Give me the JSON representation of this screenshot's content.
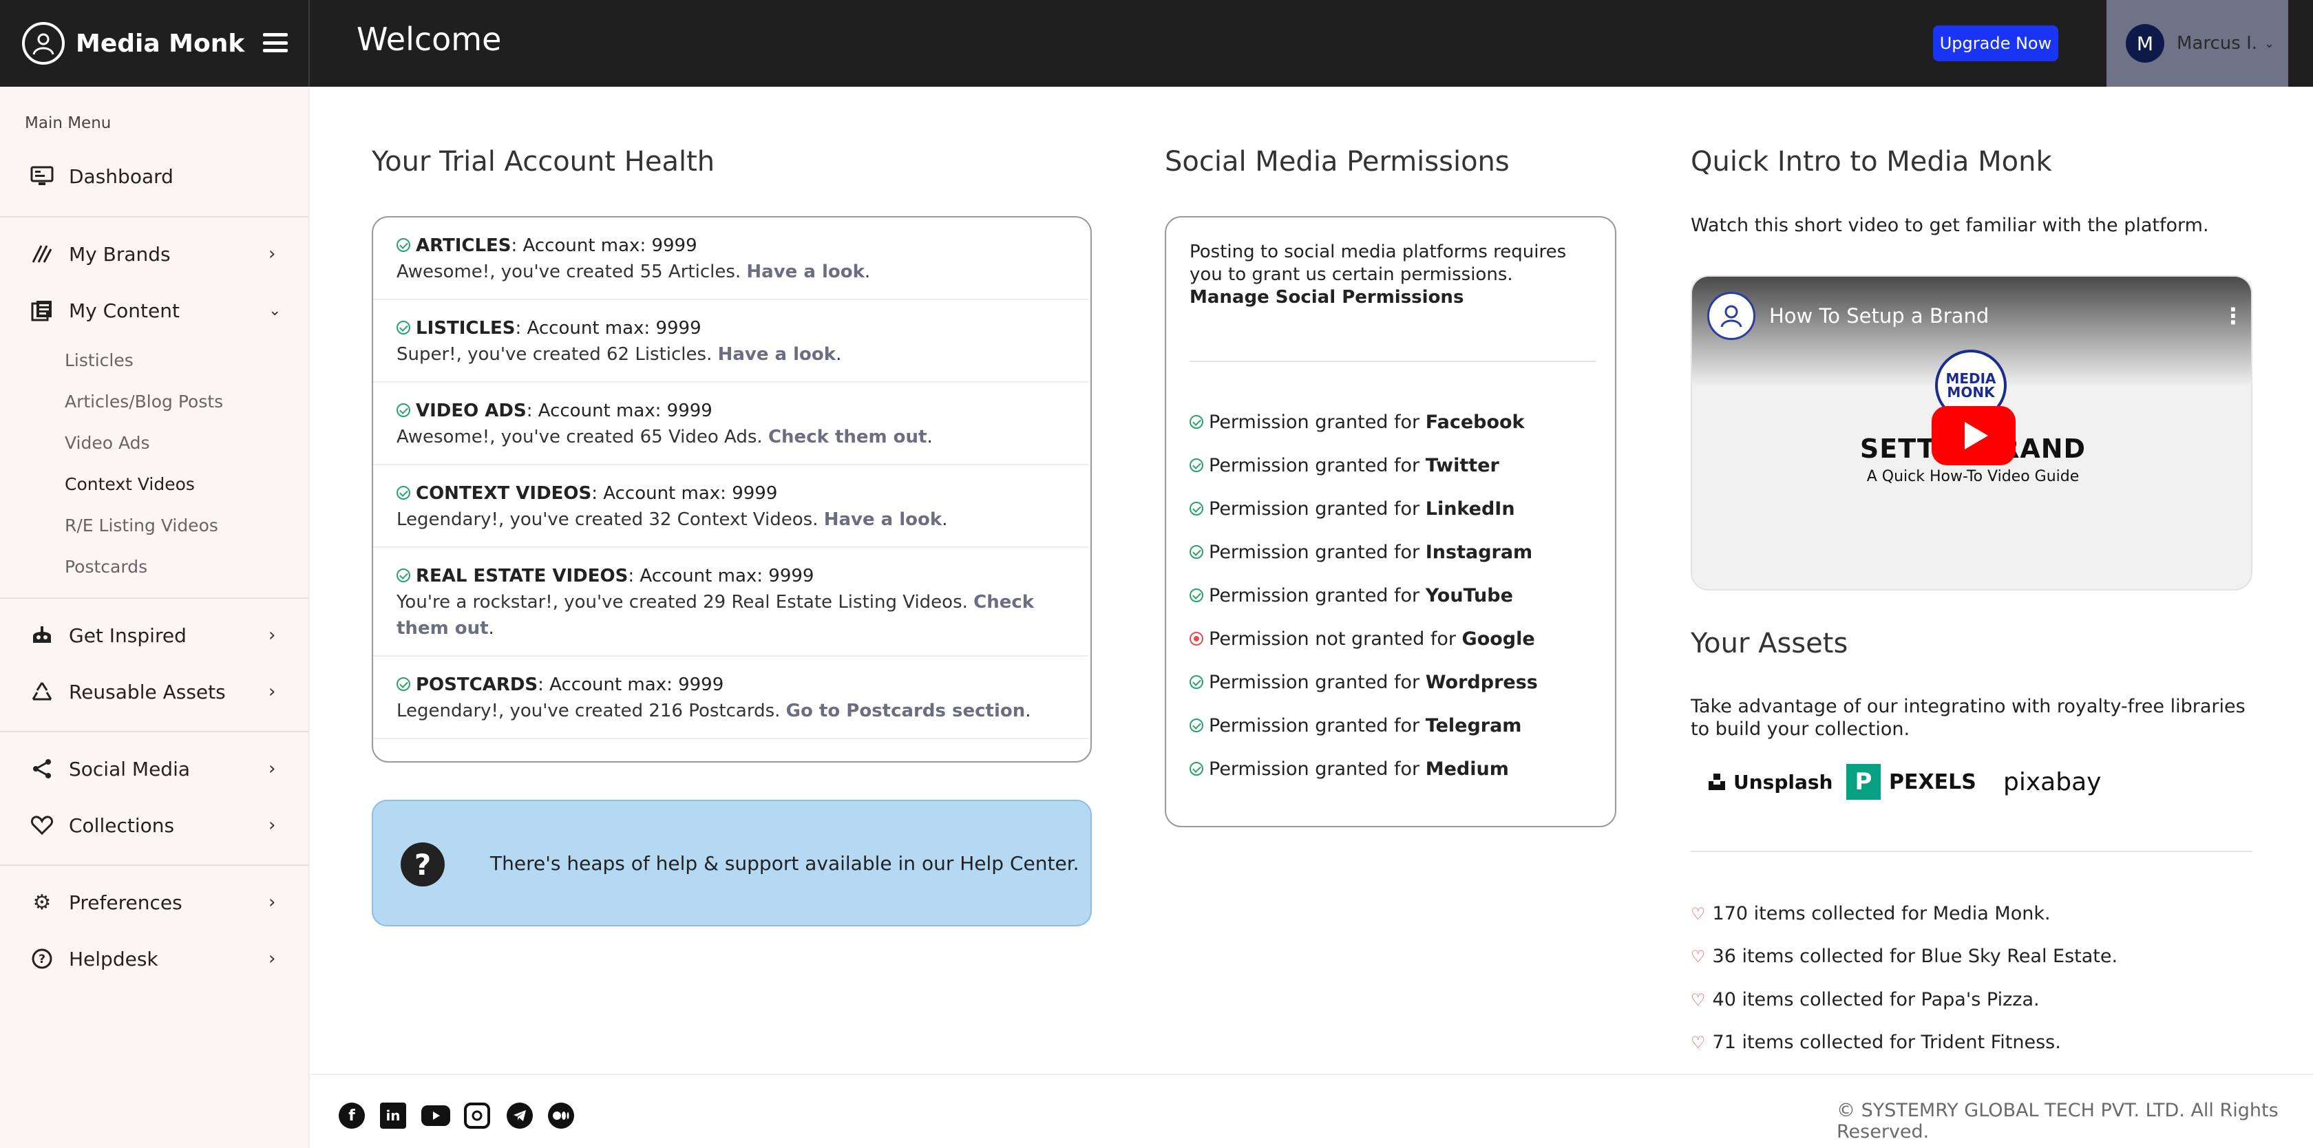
{
  "app": {
    "name": "Media Monk",
    "page_title": "Welcome"
  },
  "header": {
    "upgrade_label": "Upgrade Now",
    "user_initial": "M",
    "user_name": "Marcus I.",
    "caret": "⌄"
  },
  "sidebar": {
    "section_label": "Main Menu",
    "items": [
      {
        "label": "Dashboard",
        "icon": "monitor-icon"
      },
      {
        "label": "My Brands",
        "icon": "brands-icon"
      },
      {
        "label": "My Content",
        "icon": "content-icon"
      },
      {
        "label": "Get Inspired",
        "icon": "inspired-icon"
      },
      {
        "label": "Reusable Assets",
        "icon": "recycle-icon"
      },
      {
        "label": "Social Media",
        "icon": "share-icon"
      },
      {
        "label": "Collections",
        "icon": "heart-icon"
      },
      {
        "label": "Preferences",
        "icon": "gear-icon"
      },
      {
        "label": "Helpdesk",
        "icon": "help-icon"
      }
    ],
    "content_sub": [
      "Listicles",
      "Articles/Blog Posts",
      "Video Ads",
      "Context Videos",
      "R/E Listing Videos",
      "Postcards"
    ]
  },
  "health": {
    "title": "Your Trial Account Health",
    "rows": [
      {
        "name": "ARTICLES",
        "max": ": Account max: 9999",
        "msg": "Awesome!, you've created 55 Articles. ",
        "link": "Have a look",
        "end": "."
      },
      {
        "name": "LISTICLES",
        "max": ": Account max: 9999",
        "msg": "Super!, you've created 62 Listicles. ",
        "link": "Have a look",
        "end": "."
      },
      {
        "name": "VIDEO ADS",
        "max": ": Account max: 9999",
        "msg": "Awesome!, you've created 65 Video Ads. ",
        "link": "Check them out",
        "end": "."
      },
      {
        "name": "CONTEXT VIDEOS",
        "max": ": Account max: 9999",
        "msg": "Legendary!, you've created 32 Context Videos. ",
        "link": "Have a look",
        "end": "."
      },
      {
        "name": "REAL ESTATE VIDEOS",
        "max": ": Account max: 9999",
        "msg": "You're a rockstar!, you've created 29 Real Estate Listing Videos. ",
        "link": "Check them out",
        "end": "."
      },
      {
        "name": "POSTCARDS",
        "max": ": Account max: 9999",
        "msg": "Legendary!, you've created 216 Postcards. ",
        "link": "Go to Postcards section",
        "end": "."
      }
    ],
    "help_icon": "?",
    "help_text": "There's heaps of help & support available in our Help Center."
  },
  "permissions": {
    "title": "Social Media Permissions",
    "intro": "Posting to social media platforms requires you to grant us certain permissions. ",
    "intro_link": "Manage Social Permissions",
    "items": [
      {
        "text": "Permission granted for ",
        "platform": "Facebook",
        "granted": true
      },
      {
        "text": "Permission granted for ",
        "platform": "Twitter",
        "granted": true
      },
      {
        "text": "Permission granted for ",
        "platform": "LinkedIn",
        "granted": true
      },
      {
        "text": "Permission granted for ",
        "platform": "Instagram",
        "granted": true
      },
      {
        "text": "Permission granted for ",
        "platform": "YouTube",
        "granted": true
      },
      {
        "text": "Permission not granted for ",
        "platform": "Google",
        "granted": false
      },
      {
        "text": "Permission granted for ",
        "platform": "Wordpress",
        "granted": true
      },
      {
        "text": "Permission granted for ",
        "platform": "Telegram",
        "granted": true
      },
      {
        "text": "Permission granted for ",
        "platform": "Medium",
        "granted": true
      }
    ]
  },
  "intro": {
    "title": "Quick Intro to Media Monk",
    "text": "Watch this short video to get familiar with the platform.",
    "video_title": "How To Setup a Brand",
    "video_logo": "MEDIA MONK",
    "video_heading": "SETTIN      BRAND",
    "video_sub": "A Quick How-To Video Guide"
  },
  "assets": {
    "title": "Your Assets",
    "text": "Take advantage of our integratino with royalty-free libraries to build your collection.",
    "libraries": [
      "Unsplash",
      "PEXELS",
      "pixabay"
    ],
    "collections": [
      "170 items collected for Media Monk.",
      "36 items collected for Blue Sky Real Estate.",
      "40 items collected for Papa's Pizza.",
      "71 items collected for Trident Fitness."
    ]
  },
  "footer": {
    "social": [
      "facebook-icon",
      "linkedin-icon",
      "youtube-icon",
      "instagram-icon",
      "telegram-icon",
      "medium-icon"
    ],
    "copyright": "© SYSTEMRY GLOBAL TECH PVT. LTD. All Rights Reserved."
  }
}
